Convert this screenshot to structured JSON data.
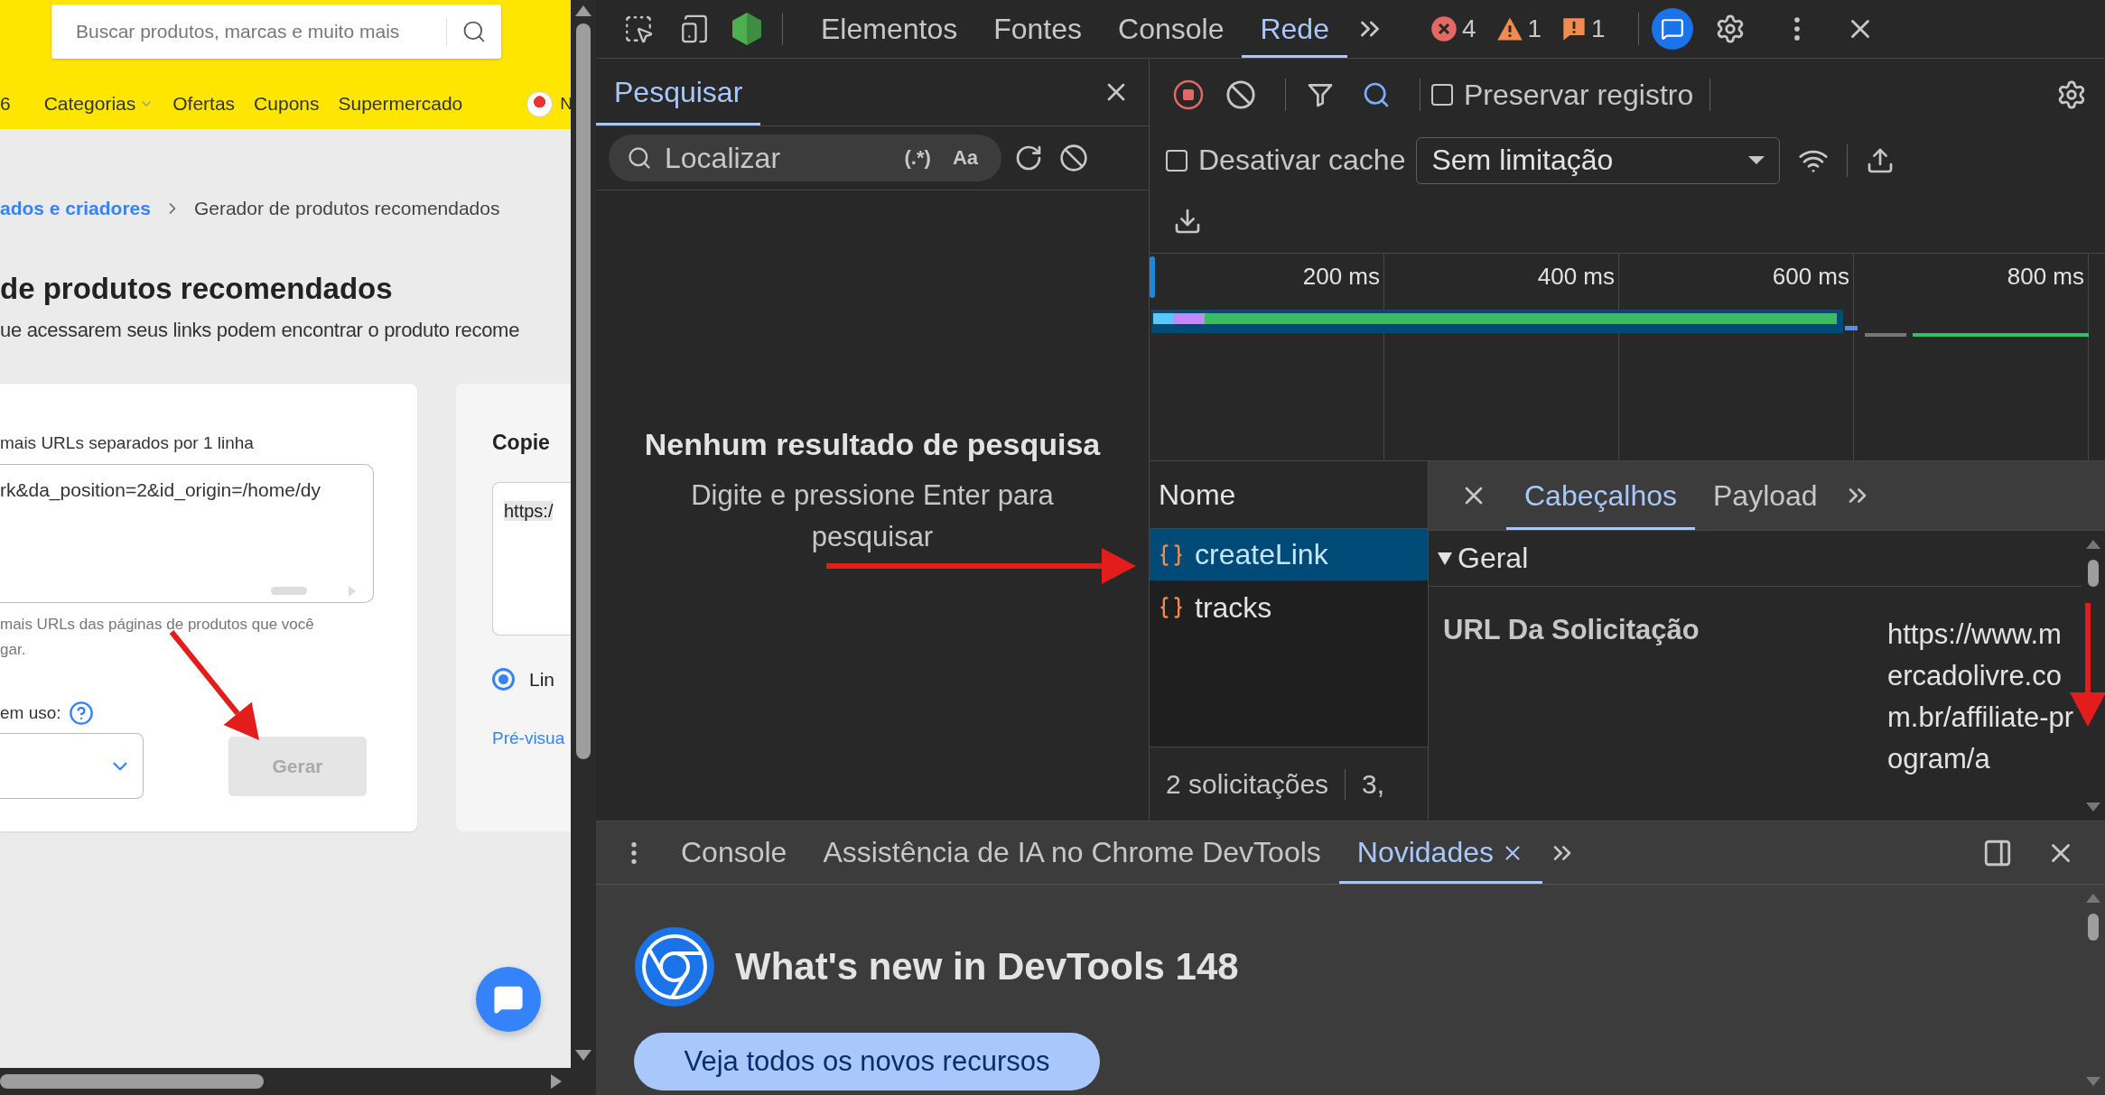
{
  "page": {
    "search": {
      "placeholder": "Buscar produtos, marcas e muito mais"
    },
    "nav": [
      {
        "label": "6",
        "dropdown": false
      },
      {
        "label": "Categorias",
        "dropdown": true
      },
      {
        "label": "Ofertas",
        "dropdown": false
      },
      {
        "label": "Cupons",
        "dropdown": false
      },
      {
        "label": "Supermercado",
        "dropdown": false
      }
    ],
    "account": "N",
    "breadcrumb": [
      {
        "label": "ados e criadores",
        "kind": "link"
      },
      {
        "label": "Gerador de produtos recomendados",
        "kind": "current"
      }
    ],
    "title": "de produtos recomendados",
    "subtitle": "ue acessarem seus links podem encontrar o produto recome",
    "form": {
      "label": "mais URLs separados por 1 linha",
      "value": "rk&da_position=2&id_origin=/home/dy",
      "help": [
        "mais URLs das páginas de produtos que você",
        "gar."
      ],
      "usage_label": "em uso:",
      "button": {
        "label": "Gerar",
        "disabled": true
      }
    },
    "result": {
      "title": "Copie",
      "value": "https:/",
      "option": {
        "label": "Lin",
        "selected": true
      },
      "link": "Pré-visua"
    }
  },
  "devtools": {
    "tabs": [
      {
        "label": "Elementos",
        "selected": false
      },
      {
        "label": "Fontes",
        "selected": false
      },
      {
        "label": "Console",
        "selected": false
      },
      {
        "label": "Rede",
        "selected": true
      }
    ],
    "badges": [
      {
        "kind": "error",
        "count": "4"
      },
      {
        "kind": "warning",
        "count": "1"
      },
      {
        "kind": "issue",
        "count": "1"
      }
    ],
    "search_panel": {
      "tab": "Pesquisar",
      "placeholder": "Localizar",
      "regex": "(.*)",
      "match_case": "Aa",
      "empty_title": "Nenhum resultado de pesquisa",
      "empty_hint": "Digite e pressione Enter para pesquisar"
    },
    "network": {
      "preserve_log": {
        "label": "Preservar registro",
        "checked": false
      },
      "disable_cache": {
        "label": "Desativar cache",
        "checked": false
      },
      "throttling": "Sem limitação",
      "ticks": [
        "200 ms",
        "400 ms",
        "600 ms",
        "800 ms"
      ],
      "name_header": "Nome",
      "requests": [
        {
          "name": "createLink",
          "selected": true
        },
        {
          "name": "tracks",
          "selected": false
        }
      ],
      "summary": [
        "2 solicitações",
        "3,"
      ],
      "detail_tabs": [
        {
          "label": "Cabeçalhos",
          "selected": true
        },
        {
          "label": "Payload",
          "selected": false
        }
      ],
      "section": {
        "title": "Geral",
        "expanded": true
      },
      "headers": [
        {
          "name": "URL Da Solicitação",
          "value": "https://www.mercadolivre.com.br/affiliate-program/a"
        }
      ]
    },
    "drawer": {
      "tabs": [
        {
          "label": "Console",
          "selected": false,
          "closable": false
        },
        {
          "label": "Assistência de IA no Chrome DevTools",
          "selected": false,
          "closable": false
        },
        {
          "label": "Novidades",
          "selected": true,
          "closable": true
        }
      ],
      "heading": "What's new in DevTools 148",
      "button": "Veja todos os novos recursos"
    }
  }
}
